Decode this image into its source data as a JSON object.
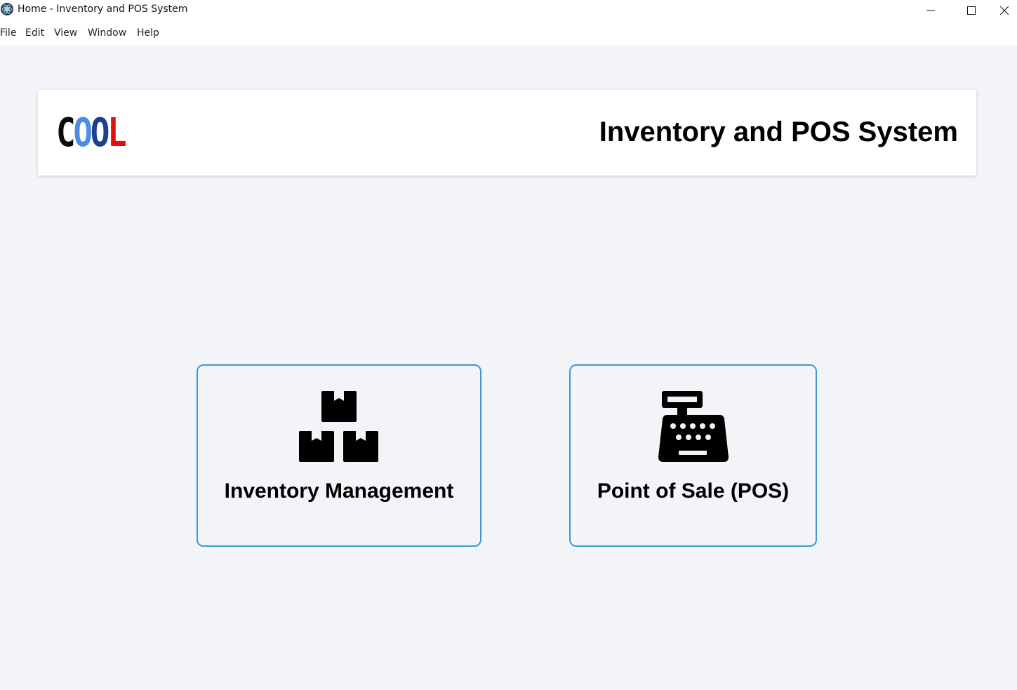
{
  "window": {
    "title": "Home - Inventory and POS System",
    "icon": "app-icon",
    "controls": [
      "minimize-icon",
      "maximize-icon",
      "close-icon"
    ]
  },
  "menu": {
    "items": [
      {
        "label": "File"
      },
      {
        "label": "Edit"
      },
      {
        "label": "View"
      },
      {
        "label": "Window"
      },
      {
        "label": "Help"
      }
    ]
  },
  "header": {
    "logo": {
      "letters": [
        "C",
        "O",
        "O",
        "L"
      ],
      "colors": [
        "#0b0b0b",
        "#4a90e2",
        "#1f3f8f",
        "#e01010"
      ]
    },
    "title": "Inventory and POS System"
  },
  "tiles": [
    {
      "label": "Inventory Management",
      "icon": "boxes-icon"
    },
    {
      "label": "Point of Sale (POS)",
      "icon": "cash-register-icon"
    }
  ],
  "colors": {
    "background": "#f3f4f8",
    "tile_border": "#3b9ad6",
    "card": "#ffffff"
  }
}
